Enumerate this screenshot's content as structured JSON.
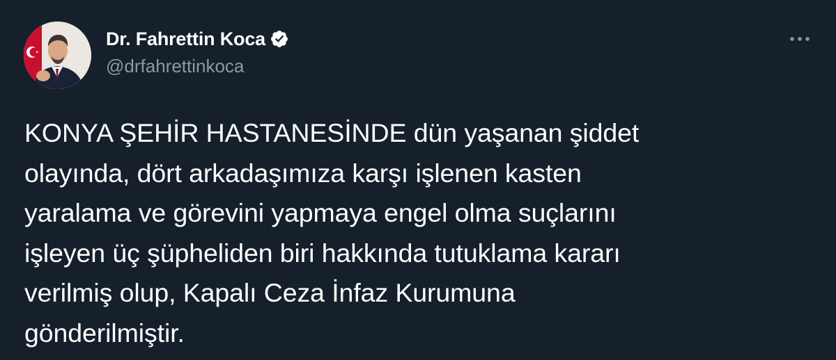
{
  "tweet": {
    "author": {
      "display_name": "Dr. Fahrettin Koca",
      "handle": "@drfahrettinkoca",
      "verified": true,
      "avatar_icon": "profile-photo"
    },
    "more_icon": "more-horizontal-icon",
    "text_lines": [
      "KONYA ŞEHİR HASTANESİNDE dün yaşanan şiddet",
      "olayında, dört arkadaşımıza karşı işlenen kasten",
      "yaralama ve görevini yapmaya engel olma suçlarını",
      "işleyen üç şüpheliden biri hakkında tutuklama kararı",
      "verilmiş olup, Kapalı Ceza İnfaz Kurumuna",
      "gönderilmiştir."
    ]
  },
  "colors": {
    "background": "#15202b",
    "text_primary": "#ffffff",
    "text_secondary": "#8b98a5",
    "verified_badge": "#ffffff"
  }
}
